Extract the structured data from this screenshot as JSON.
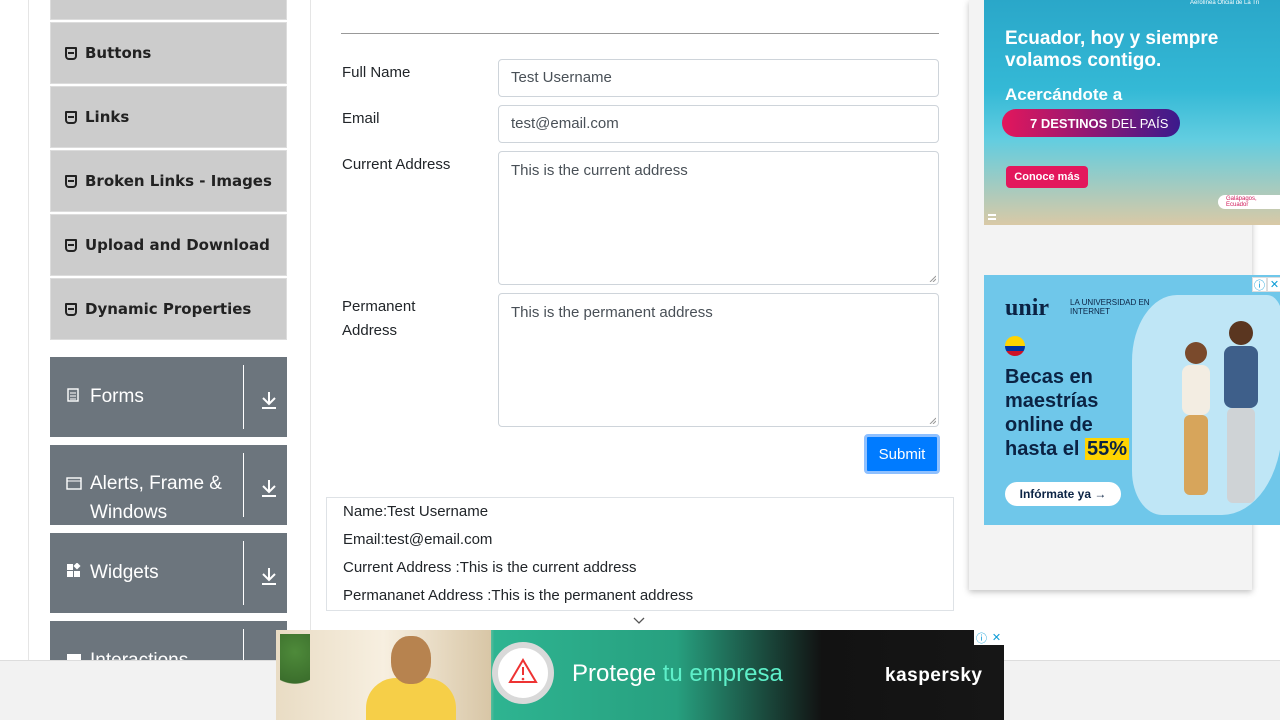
{
  "sidebar": {
    "sub_items": [
      {
        "label": "Buttons",
        "icon": "html5-icon"
      },
      {
        "label": "Links",
        "icon": "html5-icon"
      },
      {
        "label": "Broken Links - Images",
        "icon": "html5-icon"
      },
      {
        "label": "Upload and Download",
        "icon": "html5-icon"
      },
      {
        "label": "Dynamic Properties",
        "icon": "html5-icon"
      }
    ],
    "groups": [
      {
        "label": "Forms",
        "icon": "document-icon"
      },
      {
        "label": "Alerts, Frame & Windows",
        "label_line1": "Alerts, Frame &",
        "label_line2": "Windows",
        "icon": "window-icon"
      },
      {
        "label": "Widgets",
        "icon": "widgets-icon"
      },
      {
        "label": "Interactions",
        "icon": "interactions-icon"
      }
    ]
  },
  "form": {
    "full_name_label": "Full Name",
    "full_name_value": "Test Username",
    "email_label": "Email",
    "email_value": "test@email.com",
    "current_address_label": "Current Address",
    "current_address_value": "This is the current address",
    "permanent_address_label_line1": "Permanent",
    "permanent_address_label_line2": "Address",
    "permanent_address_value": "This is the permanent address",
    "submit_label": "Submit"
  },
  "output": {
    "name": "Name:Test Username",
    "email": "Email:test@email.com",
    "current_address": "Current Address :This is the current address",
    "permanent_address": "Permananet Address :This is the permanent address"
  },
  "ads": {
    "ad1": {
      "line1": "Ecuador, hoy y siempre",
      "line2": "volamos contigo.",
      "line3": "Acercándote a",
      "pill_bold": "7 DESTINOS",
      "pill_rest": "DEL PAÍS",
      "cta": "Conoce más",
      "location": "Galápagos, Ecuador",
      "brand_tag": "Aerolínea Oficial de La Tri"
    },
    "ad2": {
      "brand": "unir",
      "brand_sub": "LA UNIVERSIDAD EN INTERNET",
      "head_line1": "Becas en",
      "head_line2": "maestrías",
      "head_line3": "online de",
      "head_line4_prefix": "hasta el ",
      "head_highlight": "55%",
      "cta": "Infórmate ya →"
    },
    "bottom": {
      "text_white": "Protege",
      "text_accent": "tu empresa",
      "logo": "kaspersky"
    }
  },
  "colors": {
    "submit_blue": "#007bff",
    "sidebar_group": "#6c757d",
    "sidebar_sub": "#cccccc"
  }
}
